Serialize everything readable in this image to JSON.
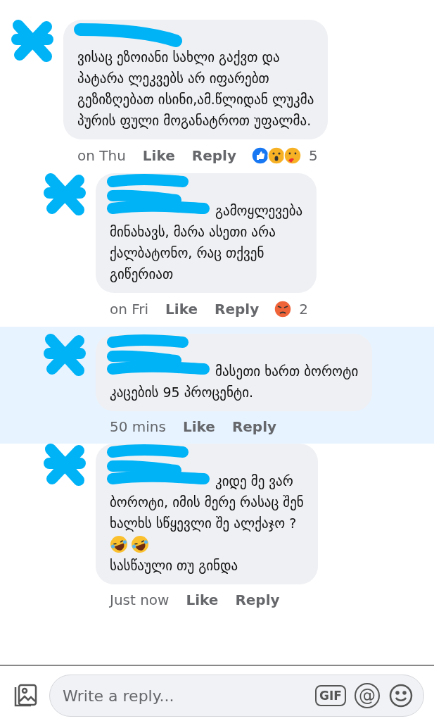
{
  "comments": [
    {
      "text": "ვისაც ეზოიანი სახლი გაქვთ და\nპატარა ლეკვებს არ იფარებთ\nგეზიზღებათ ისინი,ამ.წლიდან ლუკმა\nპურის ფული მოგანატროთ უფალმა.",
      "time": "on Thu",
      "like": "Like",
      "reply": "Reply",
      "highlighted": false,
      "reactions": [
        {
          "kind": "like"
        },
        {
          "kind": "wow"
        },
        {
          "kind": "care"
        }
      ],
      "reaction_count": "5",
      "children": [
        {
          "text": "გამოყლევება\nმინახავს, მარა ასეთი არა\nქალბატონო, რაც თქვენ\nგიწერიათ",
          "time": "on Fri",
          "like": "Like",
          "reply": "Reply",
          "highlighted": false,
          "reactions": [
            {
              "kind": "angry"
            }
          ],
          "reaction_count": "2"
        },
        {
          "text": "მასეთი ხართ ბოროტი\nკაცების 95 პროცენტი.",
          "time": "50 mins",
          "like": "Like",
          "reply": "Reply",
          "highlighted": true
        },
        {
          "text": "კიდე მე ვარ\nბოროტი, იმის მერე რასაც შენ\nხალხს სწყევლი შე ალქაჯო ?",
          "emojis": [
            {
              "kind": "laughing"
            },
            {
              "kind": "laughing"
            }
          ],
          "text_after": "სასწაული თუ გინდა",
          "time": "Just now",
          "like": "Like",
          "reply": "Reply",
          "highlighted": false
        }
      ]
    }
  ],
  "composer": {
    "placeholder": "Write a reply...",
    "gif": "GIF",
    "mention": "@"
  }
}
